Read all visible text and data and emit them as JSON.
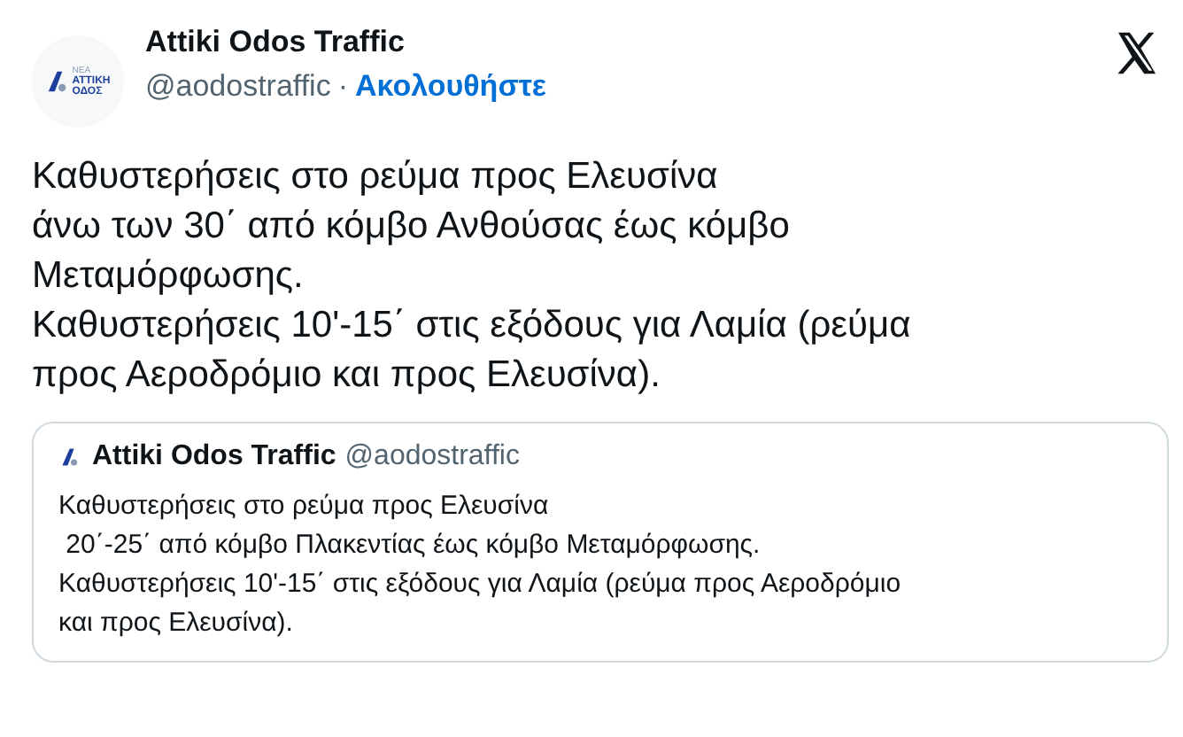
{
  "author": {
    "name": "Attiki Odos Traffic",
    "handle": "@aodostraffic",
    "separator": "·",
    "follow": "Ακολουθήστε",
    "logo_text": [
      "ΝΕΑ",
      "ΑΤΤΙΚΗ",
      "ΟΔΟΣ"
    ]
  },
  "text": "Καθυστερήσεις στο ρεύμα προς Ελευσίνα\nάνω των 30΄ από κόμβο Ανθούσας έως κόμβο Μεταμόρφωσης.\nΚαθυστερήσεις 10'-15΄ στις εξόδους για Λαμία (ρεύμα προς Αεροδρόμιο και προς Ελευσίνα).",
  "quoted": {
    "name": "Attiki Odos Traffic",
    "handle": "@aodostraffic",
    "text": "Καθυστερήσεις στο ρεύμα προς Ελευσίνα\n 20΄-25΄ από κόμβο Πλακεντίας έως κόμβο Μεταμόρφωσης.\nΚαθυστερήσεις 10'-15΄ στις εξόδους για Λαμία (ρεύμα προς Αεροδρόμιο και προς Ελευσίνα)."
  }
}
